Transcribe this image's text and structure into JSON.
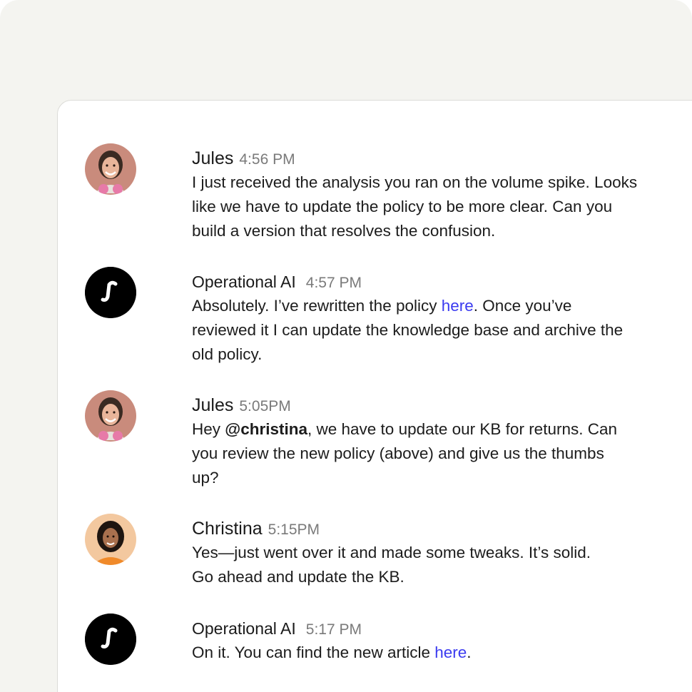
{
  "colors": {
    "background": "#f4f4f0",
    "panel": "#ffffff",
    "link": "#3b3bf0",
    "timestamp": "#7a7a7a",
    "ai_avatar": "#000000"
  },
  "messages": [
    {
      "author": "Jules",
      "time": "4:56 PM",
      "avatar": "jules-photo",
      "lines": [
        "I just received the analysis you ran on the volume spike. Looks",
        "like we have to update the policy to be more clear. Can you",
        "build a version that resolves the confusion."
      ]
    },
    {
      "author": "Operational AI",
      "time": "4:57 PM",
      "avatar": "fin-logo-icon",
      "line1_before": "Absolutely. I’ve rewritten the policy ",
      "link": "here",
      "line1_after": ". Once you’ve",
      "line2": "reviewed it I can update the knowledge base and archive the",
      "line3": "old policy."
    },
    {
      "author": "Jules",
      "time": "5:05PM",
      "avatar": "jules-photo",
      "line1_before": "Hey ",
      "mention": "@christina",
      "line1_after": ", we have to update our KB for returns. Can",
      "line2": "you review the new policy (above) and give us the thumbs",
      "line3": "up?"
    },
    {
      "author": "Christina",
      "time": "5:15PM",
      "avatar": "christina-photo",
      "lines": [
        "Yes—just went over it and made some tweaks. It’s solid.",
        "Go ahead and update the KB."
      ]
    },
    {
      "author": "Operational AI",
      "time": "5:17 PM",
      "avatar": "fin-logo-icon",
      "text_before": "On it. You can find the new article ",
      "link": "here",
      "text_after": "."
    }
  ]
}
